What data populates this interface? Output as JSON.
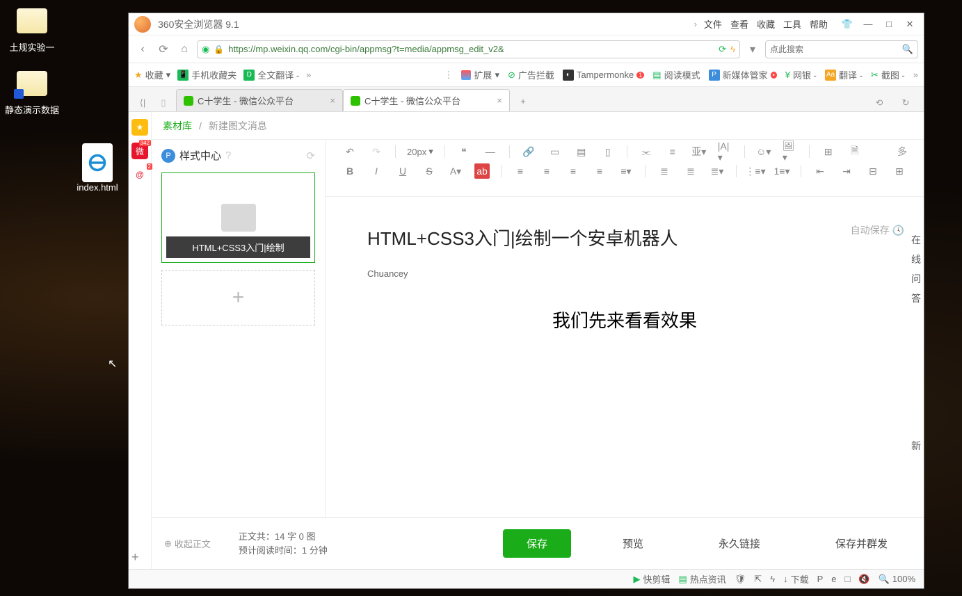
{
  "desktop": {
    "icons": [
      {
        "label": "土规实验一"
      },
      {
        "label": "静态演示数据"
      },
      {
        "label": "index.html"
      }
    ]
  },
  "browser": {
    "title": "360安全浏览器 9.1",
    "menus": [
      "文件",
      "查看",
      "收藏",
      "工具",
      "帮助"
    ],
    "url": "https://mp.weixin.qq.com/cgi-bin/appmsg?t=media/appmsg_edit_v2&",
    "search_placeholder": "点此搜索",
    "bookmarks": {
      "fav_label": "收藏",
      "mobile_fav": "手机收藏夹",
      "fulltext": "全文翻译 -",
      "extend": "扩展",
      "adblock": "广告拦截",
      "tampermonkey": "Tampermonke",
      "readmode": "阅读模式",
      "newmedia": "新媒体管家",
      "netbank": "网银 -",
      "translate": "翻译 -",
      "screenshot": "截图 -"
    },
    "tabs": [
      {
        "label": "C十学生 - 微信公众平台"
      },
      {
        "label": "C十学生 - 微信公众平台"
      }
    ]
  },
  "page": {
    "breadcrumb_lib": "素材库",
    "breadcrumb_new": "新建图文消息",
    "style_center": "样式中心",
    "card_caption": "HTML+CSS3入门|绘制",
    "autosave": "自动保存",
    "toolbar_fontsize": "20px",
    "doc_title": "HTML+CSS3入门|绘制一个安卓机器人",
    "doc_author": "Chuancey",
    "doc_body": "我们先来看看效果",
    "rail_more": "多",
    "rail_qa": "在线问答",
    "rail_new": "新"
  },
  "footer": {
    "collapse": "收起正文",
    "stats1": "正文共：14 字 0 图",
    "stats2": "预计阅读时间：1 分钟",
    "save": "保存",
    "preview": "预览",
    "permalink": "永久链接",
    "save_send": "保存并群发"
  },
  "statusbar": {
    "quickcut": "快剪辑",
    "hotnews": "热点资讯",
    "download": "下载",
    "zoom": "100%"
  }
}
